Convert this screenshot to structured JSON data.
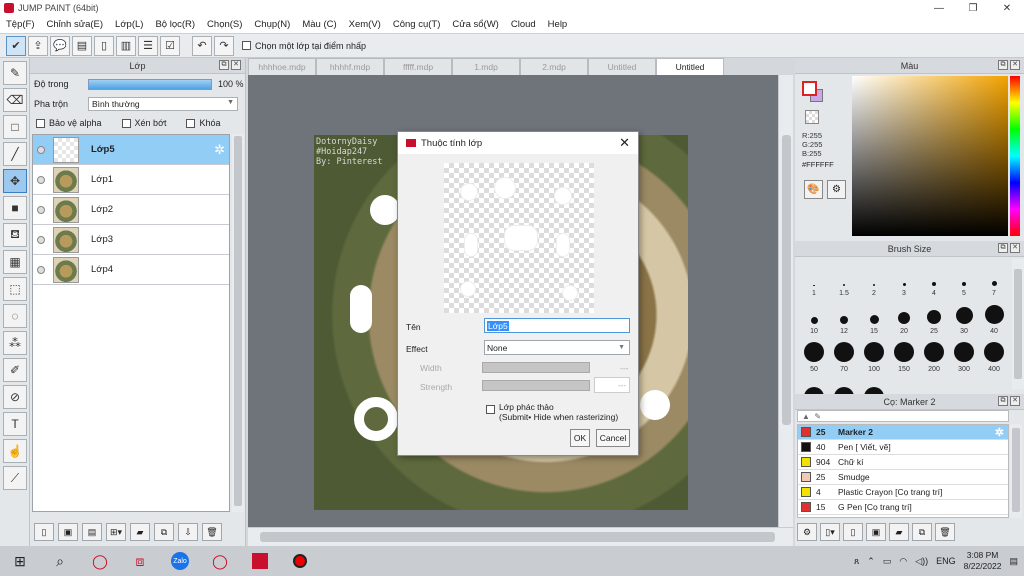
{
  "window": {
    "title": "JUMP PAINT (64bit)",
    "min": "—",
    "max": "❐",
    "close": "✕"
  },
  "menu": [
    "Tệp(F)",
    "Chỉnh sửa(E)",
    "Lớp(L)",
    "Bộ lọc(R)",
    "Chọn(S)",
    "Chụp(N)",
    "Màu (C)",
    "Xem(V)",
    "Công cụ(T)",
    "Cửa sổ(W)",
    "Cloud",
    "Help"
  ],
  "toolbar": {
    "check_label": "Chọn một lớp tại điểm nhấp"
  },
  "layer_panel": {
    "title": "Lớp",
    "opacity_label": "Độ trong",
    "opacity_value": "100 %",
    "opacity_fraction": 1.0,
    "blend_label": "Pha trộn",
    "blend_value": "Bình thường",
    "protect_alpha": "Bảo vệ alpha",
    "clipping": "Xén bớt",
    "lock": "Khóa",
    "layers": [
      {
        "name": "Lớp5",
        "selected": true
      },
      {
        "name": "Lớp1",
        "selected": false
      },
      {
        "name": "Lớp2",
        "selected": false
      },
      {
        "name": "Lớp3",
        "selected": false
      },
      {
        "name": "Lớp4",
        "selected": false
      }
    ]
  },
  "doc_tabs": [
    "hhhhoe.mdp",
    "hhhhf.mdp",
    "fffff.mdp",
    "1.mdp",
    "2.mdp",
    "Untitled",
    "Untitled"
  ],
  "active_doc_tab": 6,
  "artwork_text": [
    "DotornyDaisy",
    "#Hoidap247",
    "By: Pinterest"
  ],
  "dialog": {
    "title": "Thuộc tính lớp",
    "name_label": "Tên",
    "name_value": "Lớp5",
    "effect_label": "Effect",
    "effect_value": "None",
    "width_label": "Width",
    "width_value": "---",
    "strength_label": "Strength",
    "strength_value": "---",
    "draft_label": "Lớp phác thảo",
    "draft_sub": "(Submit• Hide when rasterizing)",
    "ok": "OK",
    "cancel": "Cancel"
  },
  "color_panel": {
    "title": "Màu",
    "r": "R:255",
    "g": "G:255",
    "b": "B:255",
    "hex": "#FFFFFF",
    "primary": "#ffffff",
    "secondary": "#c9a8e8"
  },
  "brush_panel": {
    "title": "Brush Size",
    "sizes": [
      "1",
      "1.5",
      "2",
      "3",
      "4",
      "5",
      "7",
      "10",
      "12",
      "15",
      "20",
      "25",
      "30",
      "40",
      "50",
      "70",
      "100",
      "150",
      "200",
      "300",
      "400",
      "",
      "",
      ""
    ]
  },
  "sub_panel": {
    "title": "Cọ: Marker 2",
    "items": [
      {
        "size": "25",
        "name": "Marker 2",
        "color": "#e03030",
        "selected": true
      },
      {
        "size": "40",
        "name": "Pen [ Viết, vẽ]",
        "color": "#111111",
        "selected": false
      },
      {
        "size": "904",
        "name": "Chữ kí",
        "color": "#f2e200",
        "selected": false
      },
      {
        "size": "25",
        "name": "Smudge",
        "color": "#f3c9b5",
        "selected": false
      },
      {
        "size": "4",
        "name": "Plastic Crayon [Cọ trang trí]",
        "color": "#f2e200",
        "selected": false
      },
      {
        "size": "15",
        "name": "G Pen [Cọ trang trí]",
        "color": "#e03030",
        "selected": false
      }
    ]
  },
  "taskbar": {
    "lang": "ENG",
    "time": "3:08 PM",
    "date": "8/22/2022",
    "zalo": "Zalo"
  }
}
